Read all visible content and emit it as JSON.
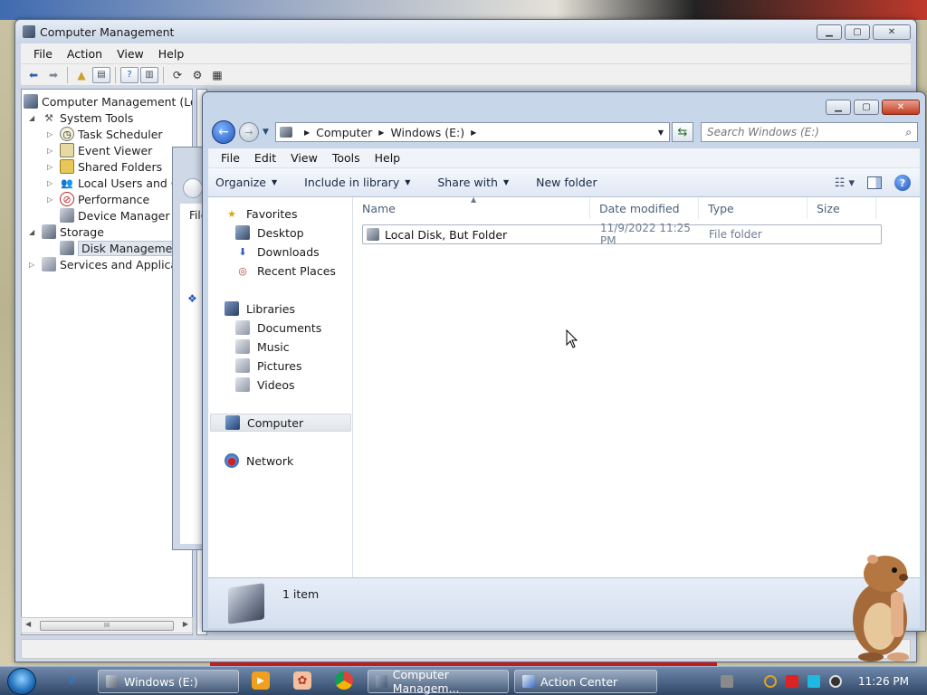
{
  "computer_management": {
    "title": "Computer Management",
    "menu": [
      "File",
      "Action",
      "View",
      "Help"
    ],
    "tree": {
      "root": "Computer Management (Local",
      "system_tools": "System Tools",
      "task_scheduler": "Task Scheduler",
      "event_viewer": "Event Viewer",
      "shared_folders": "Shared Folders",
      "local_users": "Local Users and Gro",
      "performance": "Performance",
      "device_manager": "Device Manager",
      "storage": "Storage",
      "disk_management": "Disk Management",
      "services": "Services and Applicatio"
    },
    "scroll_thumb": "III"
  },
  "hidden_window": {
    "menu_label": "File"
  },
  "explorer": {
    "breadcrumb": [
      "Computer",
      "Windows (E:)"
    ],
    "search_placeholder": "Search Windows (E:)",
    "menu": [
      "File",
      "Edit",
      "View",
      "Tools",
      "Help"
    ],
    "commands": {
      "organize": "Organize",
      "include_in_library": "Include in library",
      "share_with": "Share with",
      "new_folder": "New folder"
    },
    "nav": {
      "favorites": "Favorites",
      "desktop": "Desktop",
      "downloads": "Downloads",
      "recent_places": "Recent Places",
      "libraries": "Libraries",
      "documents": "Documents",
      "music": "Music",
      "pictures": "Pictures",
      "videos": "Videos",
      "computer": "Computer",
      "network": "Network"
    },
    "columns": {
      "name": "Name",
      "date_modified": "Date modified",
      "type": "Type",
      "size": "Size"
    },
    "files": [
      {
        "name": "Local Disk, But Folder",
        "date": "11/9/2022 11:25 PM",
        "type": "File folder",
        "size": ""
      }
    ],
    "status": "1 item"
  },
  "taskbar": {
    "tasks": {
      "explorer": "Windows (E:)",
      "computer_management": "Computer Managem...",
      "action_center": "Action Center"
    },
    "clock": "11:26 PM"
  },
  "colors": {
    "accent": "#1f55b8",
    "taskbar": "#2f4666",
    "selection": "#dde5ef"
  }
}
